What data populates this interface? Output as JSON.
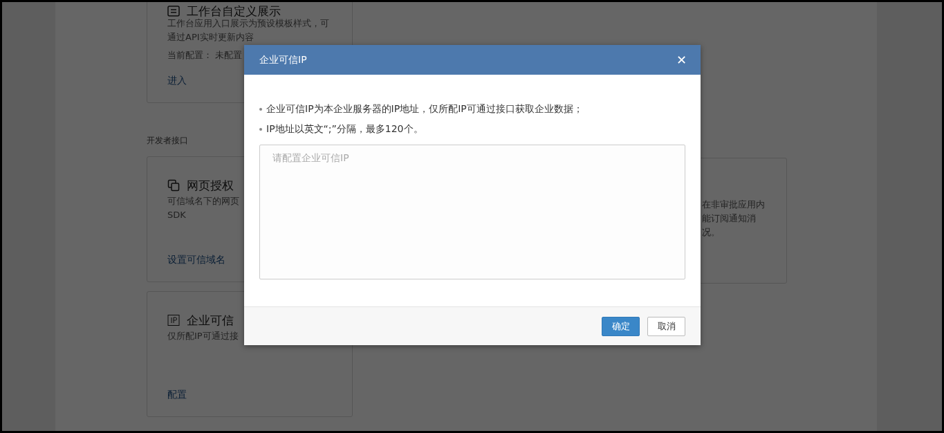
{
  "background": {
    "cards": [
      {
        "title": "工作台自定义展示",
        "lines": [
          "工作台应用入口展示为预设模板样式，可",
          "通过API实时更新内容"
        ],
        "config": "当前配置： 未配置",
        "link": "进入"
      },
      {
        "title": "网页授权",
        "lines": [
          "可信域名下的网页",
          "SDK"
        ],
        "link": "设置可信域名"
      },
      {
        "title": "企业可信",
        "lines": [
          "仅所配IP可通过接"
        ],
        "link": "配置"
      }
    ],
    "section_label": "开发者接口",
    "right_card": {
      "lines": [
        "在非审批应用内",
        "能订阅通知消",
        "况。"
      ]
    }
  },
  "dialog": {
    "title": "企业可信IP",
    "close": "✕",
    "notes": [
      "企业可信IP为本企业服务器的IP地址，仅所配IP可通过接口获取企业数据；",
      "IP地址以英文“;”分隔，最多120个。"
    ],
    "ip_field": {
      "placeholder": "请配置企业可信IP"
    },
    "buttons": [
      {
        "label": "确定",
        "kind": "primary"
      },
      {
        "label": "取消",
        "kind": "default"
      }
    ]
  }
}
